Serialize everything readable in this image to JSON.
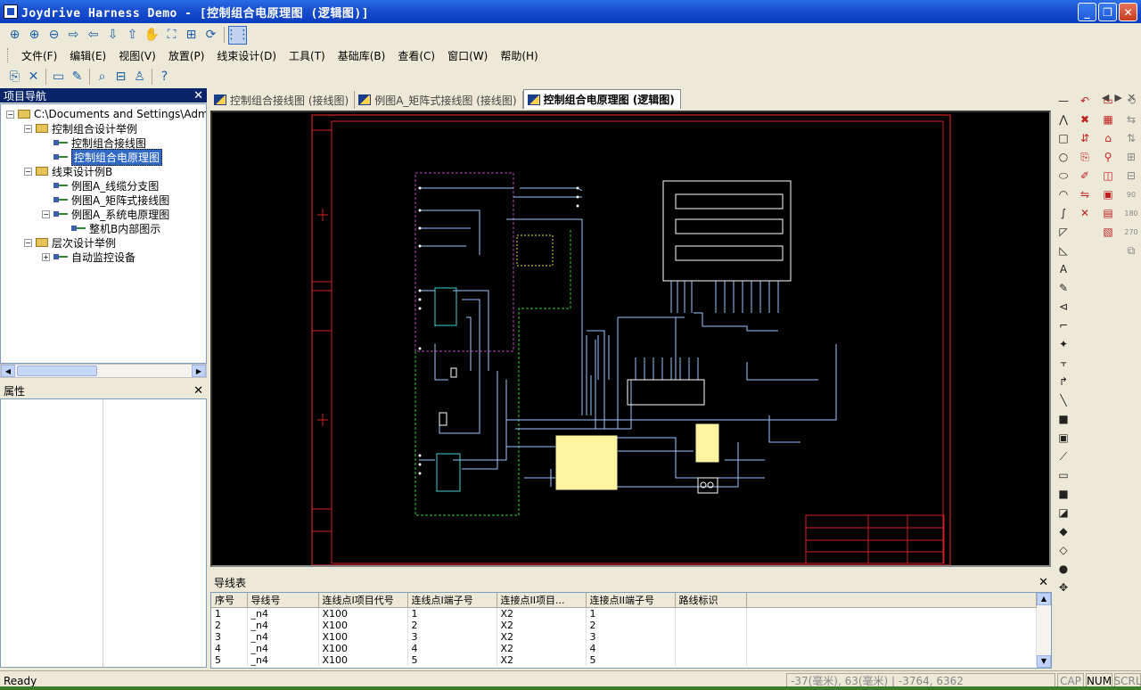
{
  "window": {
    "title": "Joydrive Harness Demo - [控制组合电原理图 (逻辑图)]"
  },
  "menu": [
    "文件(F)",
    "编辑(E)",
    "视图(V)",
    "放置(P)",
    "线束设计(D)",
    "工具(T)",
    "基础库(B)",
    "查看(C)",
    "窗口(W)",
    "帮助(H)"
  ],
  "toolbar1": {
    "icons": [
      "zoom-area-icon",
      "zoom-in-icon",
      "zoom-out-icon",
      "pan-right-icon",
      "pan-left-icon",
      "pan-down-icon",
      "pan-up-icon",
      "hand-icon",
      "fit-all-icon",
      "fit-selection-icon",
      "refresh-icon",
      "grid-icon"
    ],
    "glyphs": [
      "⊕",
      "⊕",
      "⊖",
      "⇨",
      "⇦",
      "⇩",
      "⇧",
      "✋",
      "⛶",
      "⊞",
      "⟳",
      "⋮⋮"
    ]
  },
  "toolbar2": {
    "icons": [
      "properties-icon",
      "delete-icon",
      "component-icon",
      "pen-icon",
      "search-icon",
      "connector-icon",
      "person-icon",
      "help-icon"
    ],
    "glyphs": [
      "⎘",
      "✕",
      "▭",
      "✎",
      "⌕",
      "⊟",
      "♙",
      "?"
    ]
  },
  "nav": {
    "title": "项目导航",
    "close": "✕",
    "tree": [
      {
        "label": "C:\\Documents and Settings\\Administrator",
        "level": 0,
        "kind": "folder",
        "exp": "−"
      },
      {
        "label": "控制组合设计举例",
        "level": 1,
        "kind": "folder",
        "exp": "−"
      },
      {
        "label": "控制组合接线图",
        "level": 2,
        "kind": "doc",
        "exp": ""
      },
      {
        "label": "控制组合电原理图",
        "level": 2,
        "kind": "doc",
        "exp": "",
        "selected": true
      },
      {
        "label": "线束设计例B",
        "level": 1,
        "kind": "folder",
        "exp": "−"
      },
      {
        "label": "例图A_线缆分支图",
        "level": 2,
        "kind": "doc",
        "exp": ""
      },
      {
        "label": "例图A_矩阵式接线图",
        "level": 2,
        "kind": "doc",
        "exp": ""
      },
      {
        "label": "例图A_系统电原理图",
        "level": 2,
        "kind": "doc",
        "exp": "−"
      },
      {
        "label": "整机B内部图示",
        "level": 3,
        "kind": "doc",
        "exp": ""
      },
      {
        "label": "层次设计举例",
        "level": 1,
        "kind": "folder",
        "exp": "−"
      },
      {
        "label": "自动监控设备",
        "level": 2,
        "kind": "doc",
        "exp": "+"
      }
    ]
  },
  "properties": {
    "title": "属性",
    "close": "✕"
  },
  "tabs": [
    {
      "label": "控制组合接线图 (接线图)",
      "active": false
    },
    {
      "label": "例图A_矩阵式接线图 (接线图)",
      "active": false
    },
    {
      "label": "控制组合电原理图 (逻辑图)",
      "active": true
    }
  ],
  "tab_nav": {
    "prev": "◀",
    "next": "▶",
    "close": "✕"
  },
  "wire_table": {
    "title": "导线表",
    "close": "✕",
    "columns": [
      "序号",
      "导线号",
      "连线点I项目代号",
      "连线点I端子号",
      "连接点II项目...",
      "连接点II端子号",
      "路线标识"
    ],
    "rows": [
      [
        "1",
        "_n4",
        "X100",
        "1",
        "X2",
        "1",
        ""
      ],
      [
        "2",
        "_n4",
        "X100",
        "2",
        "X2",
        "2",
        ""
      ],
      [
        "3",
        "_n4",
        "X100",
        "3",
        "X2",
        "3",
        ""
      ],
      [
        "4",
        "_n4",
        "X100",
        "4",
        "X2",
        "4",
        ""
      ],
      [
        "5",
        "_n4",
        "X100",
        "5",
        "X2",
        "5",
        ""
      ]
    ]
  },
  "status": {
    "ready": "Ready",
    "coords": "-37(毫米), 63(毫米)  | -3764, 6362",
    "cap": "CAP",
    "num": "NUM",
    "scrl": "SCRL"
  },
  "colors": {
    "canvas_bg": "#000000",
    "frame_red": "#d42020",
    "wire_blue": "#9cc6ff",
    "dash_magenta": "#c040c0",
    "dash_green": "#30d030",
    "component_yellow": "#fff4a0"
  }
}
